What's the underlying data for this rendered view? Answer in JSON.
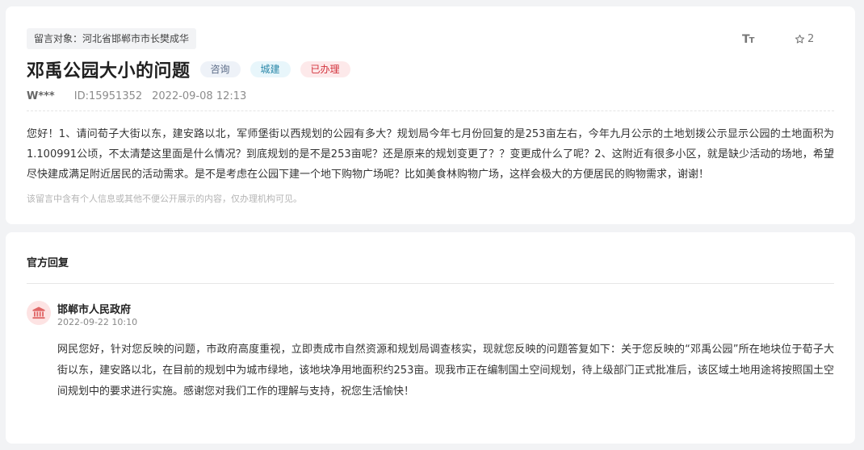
{
  "message": {
    "target_label": "留言对象：河北省邯郸市市长樊成华",
    "title": "邓禹公园大小的问题",
    "tags": [
      "咨询",
      "城建",
      "已办理"
    ],
    "author": "W***",
    "id_text": "ID:15951352",
    "datetime": "2022-09-08 12:13",
    "font_toggle_label": "TT",
    "star_count": "2",
    "body": "您好！1、请问荀子大街以东，建安路以北，军师堡街以西规划的公园有多大？规划局今年七月份回复的是253亩左右，今年九月公示的土地划拨公示显示公园的土地面积为1.100991公顷，不太清楚这里面是什么情况？到底规划的是不是253亩呢？还是原来的规划变更了？？变更成什么了呢？2、这附近有很多小区，就是缺少活动的场地，希望尽快建成满足附近居民的活动需求。是不是考虑在公园下建一个地下购物广场呢？比如美食林购物广场，这样会极大的方便居民的购物需求，谢谢！",
    "privacy_note": "该留言中含有个人信息或其他不便公开展示的内容，仅办理机构可见。"
  },
  "reply": {
    "heading": "官方回复",
    "org_name": "邯郸市人民政府",
    "datetime": "2022-09-22 10:10",
    "body": "网民您好，针对您反映的问题，市政府高度重视，立即责成市自然资源和规划局调查核实，现就您反映的问题答复如下：关于您反映的“邓禹公园”所在地块位于荀子大街以东，建安路以北，在目前的规划中为城市绿地，该地块净用地面积约253亩。现我市正在编制国土空间规划，待上级部门正式批准后，该区域土地用途将按照国土空间规划中的要求进行实施。感谢您对我们工作的理解与支持，祝您生活愉快！"
  },
  "icons": {
    "star": "star-outline-icon",
    "font_size": "font-size-icon",
    "government": "government-building-icon"
  },
  "colors": {
    "tag_consult_text": "#5b6b86",
    "tag_build_text": "#2a87a8",
    "tag_done_text": "#d2323c",
    "gov_icon": "#e06666"
  }
}
